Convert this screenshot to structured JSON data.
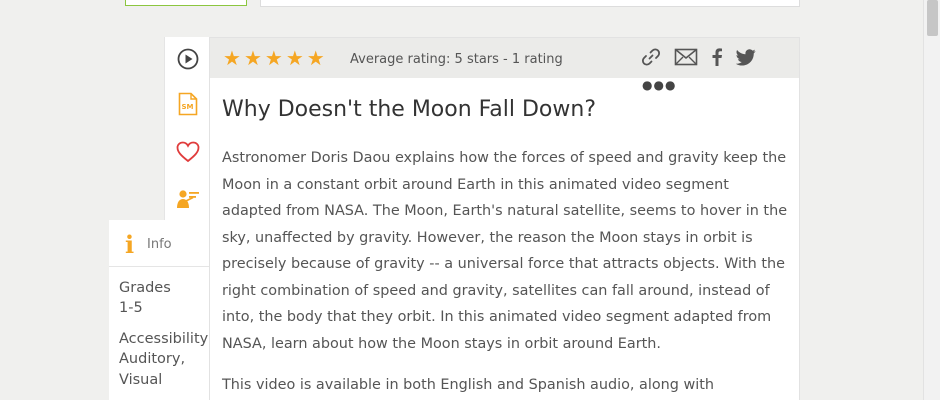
{
  "rating": {
    "stars": 5,
    "text": "Average rating: 5 stars - 1 rating"
  },
  "resource": {
    "title": "Why Doesn't the Moon Fall Down?",
    "description": "Astronomer Doris Daou explains how the forces of speed and gravity keep the Moon in a constant orbit around Earth in this animated video segment adapted from NASA. The Moon, Earth's natural satellite, seems to hover in the sky, unaffected by gravity. However, the reason the Moon stays in orbit is precisely because of gravity -- a universal force that attracts objects. With the right combination of speed and gravity, satellites can fall around, instead of into, the body that they orbit. In this animated video segment adapted from NASA, learn about how the Moon stays in orbit around Earth.",
    "description_2": "This video is available in both English and Spanish audio, along with"
  },
  "info": {
    "tab_label": "Info",
    "grades_label": "Grades",
    "grades_value": "1-5",
    "accessibility_label": "Accessibility",
    "accessibility_value_1": "Auditory,",
    "accessibility_value_2": "Visual"
  },
  "icons": {
    "rail": [
      "play-icon",
      "sm-document-icon",
      "heart-icon",
      "teacher-icon"
    ],
    "share": [
      "link-icon",
      "email-icon",
      "facebook-icon",
      "twitter-icon",
      "more-icon"
    ]
  },
  "colors": {
    "accent": "#f5a623",
    "favorite": "#e03c3c",
    "rating_bar": "#ebebe9"
  }
}
